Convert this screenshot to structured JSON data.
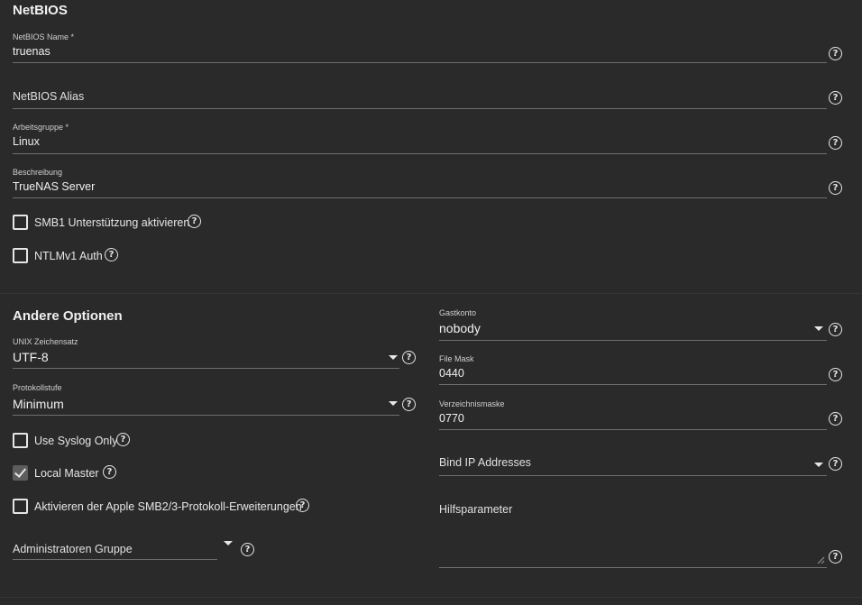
{
  "netbios": {
    "title": "NetBIOS",
    "name_label": "NetBIOS Name *",
    "name_value": "truenas",
    "alias_placeholder": "NetBIOS Alias",
    "workgroup_label": "Arbeitsgruppe *",
    "workgroup_value": "Linux",
    "description_label": "Beschreibung",
    "description_value": "TrueNAS Server",
    "smb1_label": "SMB1 Unterstützung aktivieren",
    "smb1_checked": false,
    "ntlmv1_label": "NTLMv1 Auth",
    "ntlmv1_checked": false
  },
  "other": {
    "title": "Andere Optionen",
    "charset_label": "UNIX Zeichensatz",
    "charset_value": "UTF-8",
    "loglevel_label": "Protokollstufe",
    "loglevel_value": "Minimum",
    "syslog_label": "Use Syslog Only",
    "syslog_checked": false,
    "localmaster_label": "Local Master",
    "localmaster_checked": true,
    "apple_label": "Aktivieren der Apple SMB2/3-Protokoll-Erweiterungen",
    "apple_checked": false,
    "admin_group_placeholder": "Administratoren Gruppe",
    "guest_label": "Gastkonto",
    "guest_value": "nobody",
    "filemask_label": "File Mask",
    "filemask_value": "0440",
    "dirmask_label": "Verzeichnismaske",
    "dirmask_value": "0770",
    "bindip_placeholder": "Bind IP Addresses",
    "aux_placeholder": "Hilfsparameter"
  },
  "help_glyph": "?",
  "icons": [
    "help-circle-icon",
    "dropdown-arrow-icon",
    "checkbox-icon",
    "checkmark-icon",
    "resize-handle-icon"
  ]
}
